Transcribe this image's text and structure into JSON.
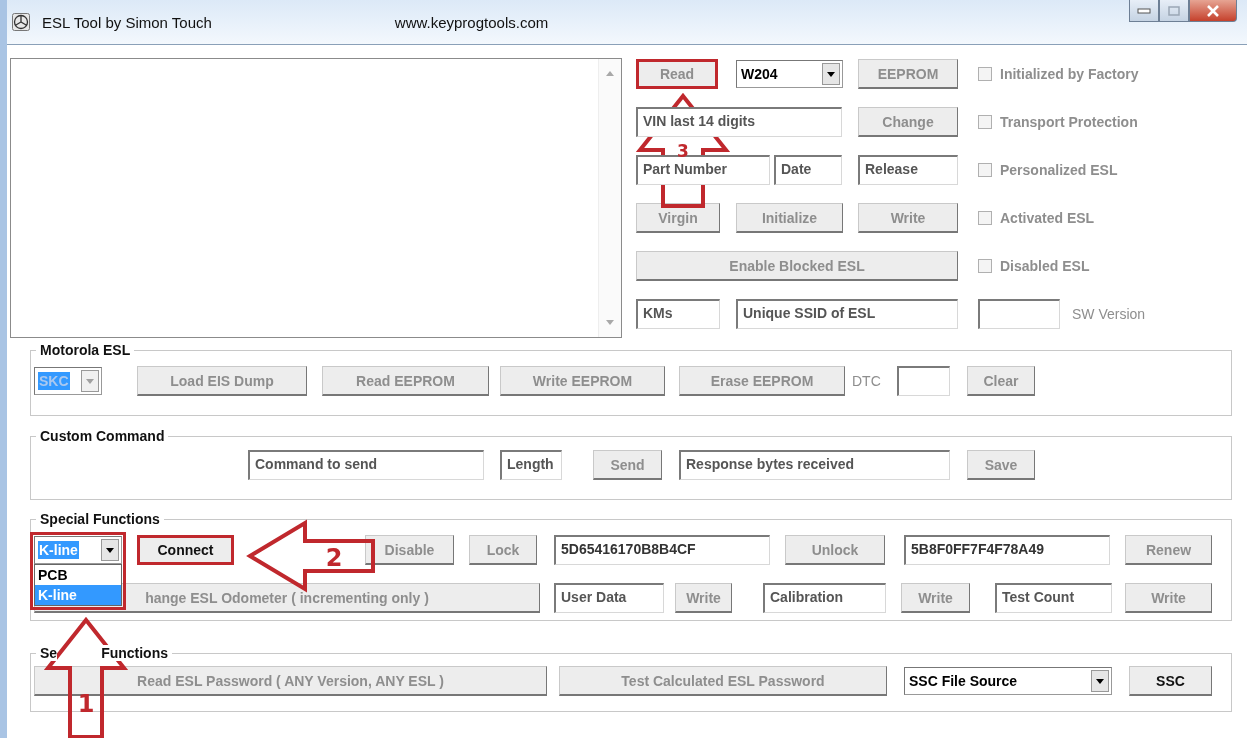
{
  "window": {
    "title": "ESL Tool by Simon Touch",
    "url": "www.keyprogtools.com"
  },
  "top": {
    "controls": [
      {
        "kind": "button",
        "label": "Read",
        "disabled": true,
        "highlighted": true
      },
      {
        "kind": "combo",
        "value": "W204",
        "disabled": false,
        "value_selected": false
      },
      {
        "kind": "button",
        "label": "EEPROM",
        "disabled": true
      },
      {
        "kind": "checkbox",
        "label": "Initialized by Factory",
        "checked": false,
        "disabled": true
      },
      {
        "kind": "field",
        "placeholder": "VIN last 14 digits"
      },
      {
        "kind": "button",
        "label": "Change",
        "disabled": true
      },
      {
        "kind": "checkbox",
        "label": "Transport Protection",
        "checked": false,
        "disabled": true
      },
      {
        "kind": "field",
        "placeholder": "Part Number"
      },
      {
        "kind": "field",
        "placeholder": "Date"
      },
      {
        "kind": "field",
        "placeholder": "Release"
      },
      {
        "kind": "checkbox",
        "label": "Personalized ESL",
        "checked": false,
        "disabled": true
      },
      {
        "kind": "button",
        "label": "Virgin",
        "disabled": true
      },
      {
        "kind": "button",
        "label": "Initialize",
        "disabled": true
      },
      {
        "kind": "button",
        "label": "Write",
        "disabled": true
      },
      {
        "kind": "checkbox",
        "label": "Activated ESL",
        "checked": false,
        "disabled": true
      },
      {
        "kind": "button",
        "label": "Enable Blocked ESL",
        "disabled": true
      },
      {
        "kind": "checkbox",
        "label": "Disabled ESL",
        "checked": false,
        "disabled": true
      },
      {
        "kind": "field",
        "placeholder": "KMs"
      },
      {
        "kind": "field",
        "placeholder": "Unique SSID of ESL"
      },
      {
        "kind": "field"
      },
      {
        "kind": "label",
        "label": "SW Version",
        "disabled": true
      }
    ]
  },
  "groups": [
    {
      "title_parts": [
        "Motorola ESL"
      ],
      "controls": [
        {
          "kind": "combo",
          "value": "SKC",
          "disabled": true,
          "value_selected": true
        },
        {
          "kind": "button",
          "label": "Load EIS Dump",
          "disabled": true
        },
        {
          "kind": "button",
          "label": "Read EEPROM",
          "disabled": true
        },
        {
          "kind": "button",
          "label": "Write EEPROM",
          "disabled": true
        },
        {
          "kind": "button",
          "label": "Erase EEPROM",
          "disabled": true
        },
        {
          "kind": "label",
          "label": "DTC",
          "disabled": true
        },
        {
          "kind": "field"
        },
        {
          "kind": "button",
          "label": "Clear",
          "disabled": true
        }
      ]
    },
    {
      "title_parts": [
        "Custom Command"
      ],
      "controls": [
        {
          "kind": "field",
          "placeholder": "Command to send"
        },
        {
          "kind": "field",
          "placeholder": "Length"
        },
        {
          "kind": "button",
          "label": "Send",
          "disabled": true
        },
        {
          "kind": "field",
          "placeholder": "Response bytes received"
        },
        {
          "kind": "button",
          "label": "Save",
          "disabled": true
        }
      ]
    },
    {
      "title_parts": [
        "Special Functions"
      ],
      "controls": [
        {
          "kind": "combo",
          "value": "K-line",
          "disabled": false,
          "value_selected": true,
          "highlighted": true,
          "options": [
            {
              "label": "PCB",
              "selected": false
            },
            {
              "label": "K-line",
              "selected": true
            }
          ]
        },
        {
          "kind": "button",
          "label": "Connect",
          "disabled": false,
          "highlighted": true
        },
        {
          "kind": "button",
          "label": "Disable",
          "disabled": true
        },
        {
          "kind": "button",
          "label": "Lock",
          "disabled": true
        },
        {
          "kind": "field",
          "value": "5D65416170B8B4CF"
        },
        {
          "kind": "button",
          "label": "Unlock",
          "disabled": true
        },
        {
          "kind": "field",
          "value": "5B8F0FF7F4F78A49"
        },
        {
          "kind": "button",
          "label": "Renew",
          "disabled": true
        },
        {
          "kind": "button",
          "label": "hange ESL Odometer ( incrementing only )",
          "disabled": true
        },
        {
          "kind": "field",
          "placeholder": "User Data"
        },
        {
          "kind": "button",
          "label": "Write",
          "disabled": true
        },
        {
          "kind": "field",
          "placeholder": "Calibration"
        },
        {
          "kind": "button",
          "label": "Write",
          "disabled": true
        },
        {
          "kind": "field",
          "placeholder": "Test Count"
        },
        {
          "kind": "button",
          "label": "Write",
          "disabled": true
        }
      ]
    },
    {
      "title_parts": [
        "Se",
        "Functions"
      ],
      "controls": [
        {
          "kind": "button",
          "label": "Read ESL Password ( ANY Version, ANY ESL )",
          "disabled": true
        },
        {
          "kind": "button",
          "label": "Test Calculated ESL Password",
          "disabled": true
        },
        {
          "kind": "combo",
          "value": "SSC File Source",
          "disabled": false,
          "value_selected": false
        },
        {
          "kind": "button",
          "label": "SSC",
          "disabled": false
        }
      ]
    }
  ],
  "annotations": [
    {
      "number": "3"
    },
    {
      "number": "2"
    },
    {
      "number": "1"
    }
  ]
}
